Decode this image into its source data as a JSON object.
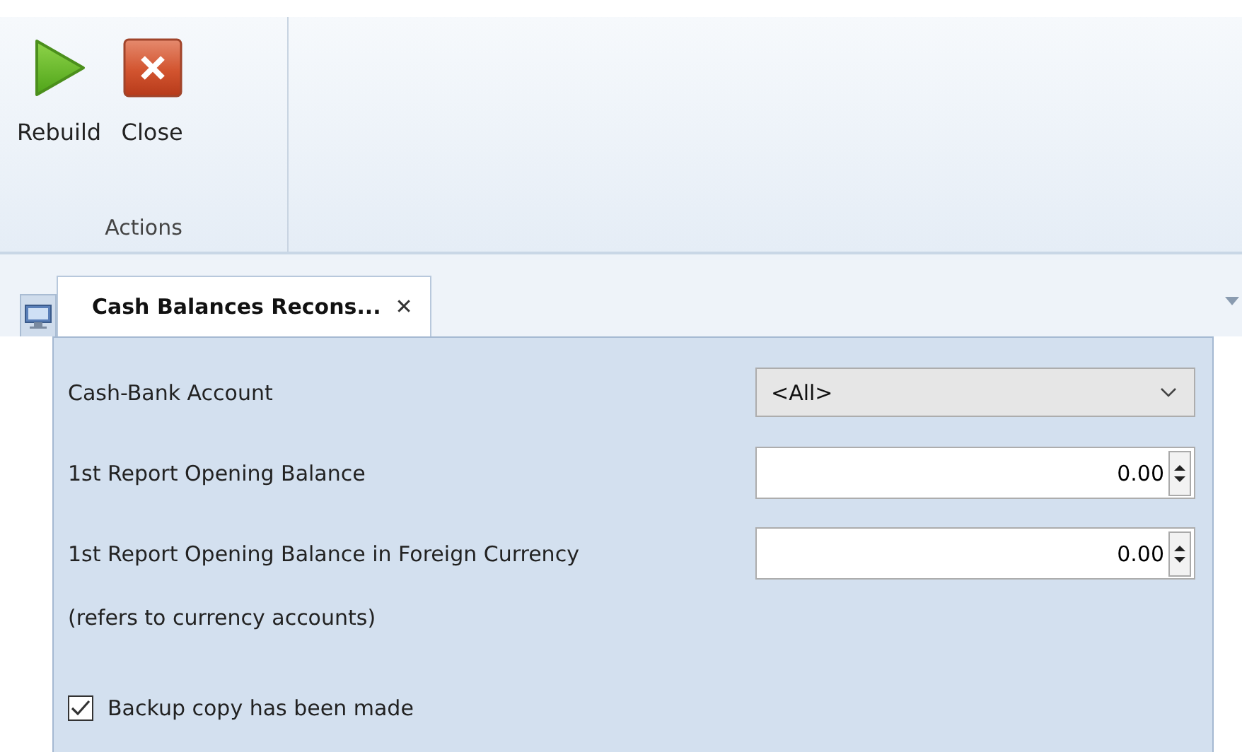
{
  "ribbon": {
    "buttons": [
      {
        "label": "Rebuild",
        "kind": "play"
      },
      {
        "label": "Close",
        "kind": "close"
      }
    ],
    "group_label": "Actions"
  },
  "tabs": [
    {
      "title": "Cash Balances Recons...",
      "close": "✕",
      "selected": true
    }
  ],
  "form": {
    "fields": [
      {
        "label": "Cash-Bank Account",
        "kind": "combo",
        "value": "<All>"
      },
      {
        "label": "1st Report Opening Balance",
        "kind": "number",
        "value": "0.00"
      },
      {
        "label": "1st Report Opening Balance in Foreign Currency",
        "kind": "number",
        "value": "0.00"
      }
    ],
    "note": "(refers to currency accounts)",
    "checkbox": {
      "label": "Backup copy has been made",
      "checked": true
    }
  }
}
